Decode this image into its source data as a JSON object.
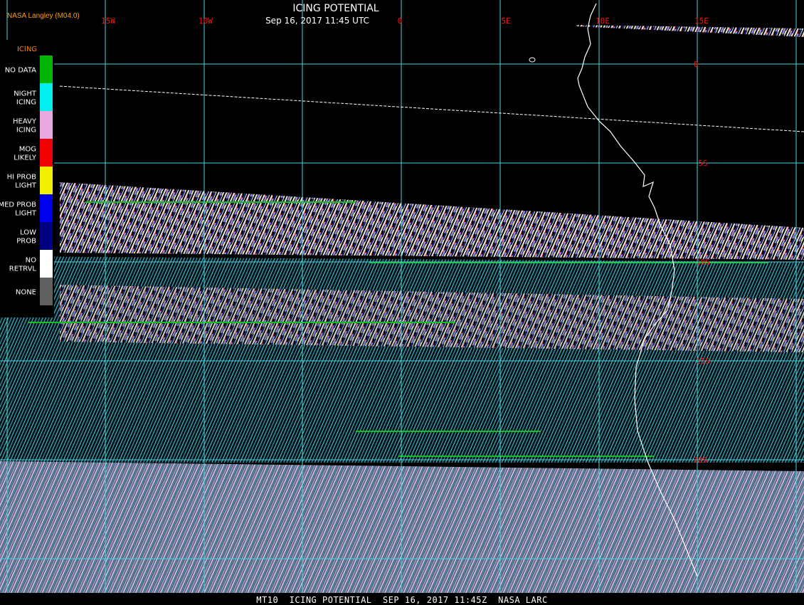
{
  "header": {
    "title": "ICING POTENTIAL",
    "subtitle": "Sep 16, 2017 11:45 UTC",
    "source": "NASA Langley (M04.0)",
    "title_color": "#ffffff",
    "source_color": "#ffa000"
  },
  "map": {
    "longitude_labels": [
      "15W",
      "10W",
      "0",
      "5E",
      "10E",
      "15E"
    ],
    "latitude_labels": [
      "0",
      "5S",
      "10S",
      "15S",
      "20S"
    ],
    "grid_color": "#44d4e0",
    "label_color": "#ff1010",
    "coast_color": "#ffffff"
  },
  "legend": {
    "title": "ICING",
    "title_color": "#ff8000",
    "items": [
      {
        "label": [
          "NO DATA"
        ],
        "color": "#00b400"
      },
      {
        "label": [
          "NIGHT",
          "ICING"
        ],
        "color": "#00f0f0"
      },
      {
        "label": [
          "HEAVY",
          "ICING"
        ],
        "color": "#e8a8e0"
      },
      {
        "label": [
          "MOG",
          "LIKELY"
        ],
        "color": "#f00000"
      },
      {
        "label": [
          "HI PROB",
          "LIGHT"
        ],
        "color": "#f0f000"
      },
      {
        "label": [
          "MED PROB",
          "LIGHT"
        ],
        "color": "#0000f0"
      },
      {
        "label": [
          "LOW",
          "PROB"
        ],
        "color": "#000080"
      },
      {
        "label": [
          "NO",
          "RETRVL"
        ],
        "color": "#ffffff"
      },
      {
        "label": [
          "NONE"
        ],
        "color": "#606060"
      }
    ]
  },
  "footer": {
    "text": "MT10  ICING POTENTIAL  SEP 16, 2017 11:45Z  NASA LARC"
  }
}
